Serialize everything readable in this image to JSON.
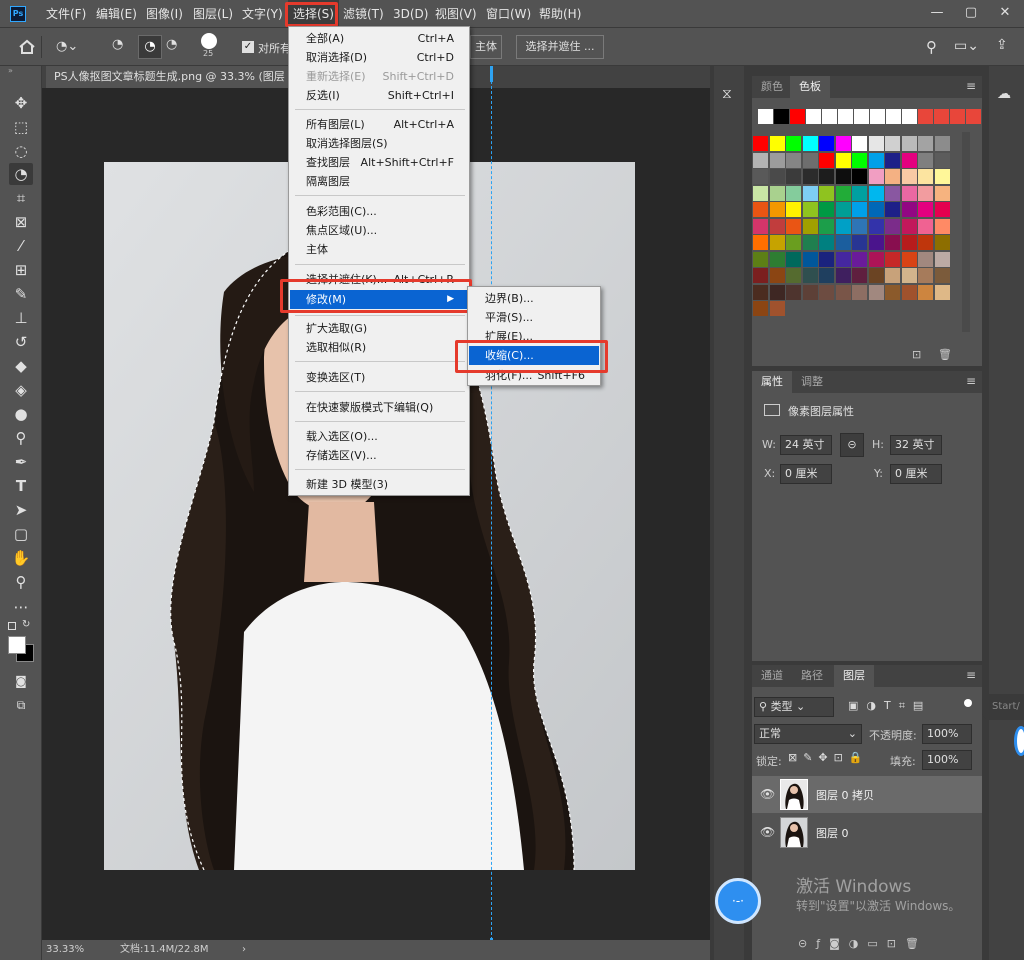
{
  "app": {
    "logo": "Ps"
  },
  "menubar": {
    "items": [
      "文件(F)",
      "编辑(E)",
      "图像(I)",
      "图层(L)",
      "文字(Y)",
      "选择(S)",
      "滤镜(T)",
      "3D(D)",
      "视图(V)",
      "窗口(W)",
      "帮助(H)"
    ],
    "window_controls": [
      "—",
      "▢",
      "✕"
    ]
  },
  "options_bar": {
    "brush_size": "25",
    "sample_all_label": "对所有",
    "subject_button": "主体",
    "select_mask_button": "选择并遮住 ..."
  },
  "document": {
    "tab_title": "PS人像抠图文章标题生成.png @ 33.3% (图层",
    "zoom": "33.33%",
    "doc_info": "文档:11.4M/22.8M"
  },
  "select_menu": {
    "items": [
      {
        "label": "全部(A)",
        "shortcut": "Ctrl+A"
      },
      {
        "label": "取消选择(D)",
        "shortcut": "Ctrl+D"
      },
      {
        "label": "重新选择(E)",
        "shortcut": "Shift+Ctrl+D",
        "disabled": true
      },
      {
        "label": "反选(I)",
        "shortcut": "Shift+Ctrl+I"
      },
      {
        "label": "所有图层(L)",
        "shortcut": "Alt+Ctrl+A"
      },
      {
        "label": "取消选择图层(S)",
        "shortcut": ""
      },
      {
        "label": "查找图层",
        "shortcut": "Alt+Shift+Ctrl+F"
      },
      {
        "label": "隔离图层",
        "shortcut": ""
      },
      {
        "label": "色彩范围(C)...",
        "shortcut": ""
      },
      {
        "label": "焦点区域(U)...",
        "shortcut": ""
      },
      {
        "label": "主体",
        "shortcut": ""
      },
      {
        "label": "选择并遮住(K)...",
        "shortcut": "Alt+Ctrl+R"
      },
      {
        "label": "修改(M)",
        "shortcut": ""
      },
      {
        "label": "扩大选取(G)",
        "shortcut": ""
      },
      {
        "label": "选取相似(R)",
        "shortcut": ""
      },
      {
        "label": "变换选区(T)",
        "shortcut": ""
      },
      {
        "label": "在快速蒙版模式下编辑(Q)",
        "shortcut": ""
      },
      {
        "label": "载入选区(O)...",
        "shortcut": ""
      },
      {
        "label": "存储选区(V)...",
        "shortcut": ""
      },
      {
        "label": "新建 3D 模型(3)",
        "shortcut": ""
      }
    ]
  },
  "modify_submenu": {
    "items": [
      {
        "label": "边界(B)...",
        "shortcut": ""
      },
      {
        "label": "平滑(S)...",
        "shortcut": ""
      },
      {
        "label": "扩展(E)...",
        "shortcut": ""
      },
      {
        "label": "收缩(C)...",
        "shortcut": ""
      },
      {
        "label": "羽化(F)...",
        "shortcut": "Shift+F6"
      }
    ]
  },
  "swatches_panel": {
    "tabs": [
      "颜色",
      "色板"
    ],
    "recent_colors": [
      "#ffffff",
      "#000000",
      "#ff0000",
      "#ffffff",
      "#ffffff",
      "#ffffff",
      "#ffffff",
      "#ffffff",
      "#ffffff",
      "#ffffff",
      "#e8463a",
      "#e8463a",
      "#e8463a",
      "#e8463a"
    ],
    "grid": [
      [
        "#ff0000",
        "#ffff00",
        "#00ff00",
        "#00ffff",
        "#0000ff",
        "#ff00ff",
        "#ffffff",
        "#e6e6e6",
        "#d0d0d0",
        "#bababa",
        "#a3a3a3",
        "#8c8c8c"
      ],
      [
        "#b3b3b3",
        "#9c9c9c",
        "#858585",
        "#6e6e6e",
        "#ff0000",
        "#ffff00",
        "#00ff00",
        "#00a0e9",
        "#1d2088",
        "#e4007f",
        "#7f7f7f",
        "#5c5c5c"
      ],
      [
        "#595959",
        "#4a4a4a",
        "#3b3b3b",
        "#2c2c2c",
        "#1d1d1d",
        "#0e0e0e",
        "#000000",
        "#f19ec2",
        "#f4b183",
        "#f8c9a4",
        "#fce4a0",
        "#fff799"
      ],
      [
        "#c9e6a5",
        "#a9d18e",
        "#84cc9c",
        "#7ecef4",
        "#8fc31f",
        "#22ac38",
        "#00a0a0",
        "#00b7ee",
        "#8957a1",
        "#ea68a2",
        "#f29c9f",
        "#f6b37f"
      ],
      [
        "#e95513",
        "#f39800",
        "#fff100",
        "#8fc31f",
        "#009944",
        "#009e96",
        "#00a0e9",
        "#0068b7",
        "#1d2088",
        "#920783",
        "#e4007f",
        "#e5004f"
      ],
      [
        "#d4356a",
        "#c13d3d",
        "#ea5514",
        "#a0a000",
        "#1c9e4a",
        "#00a0c6",
        "#2e75b6",
        "#3333aa",
        "#7b2c8a",
        "#c2185b",
        "#f06292",
        "#ff8a65"
      ],
      [
        "#ff6f00",
        "#c6a300",
        "#6a9e1f",
        "#1f7f4f",
        "#008080",
        "#1b5e9e",
        "#283593",
        "#4a148c",
        "#880e4f",
        "#b71c1c",
        "#bf360c",
        "#8d6e00"
      ],
      [
        "#5d7f16",
        "#2e7d32",
        "#00695c",
        "#01579b",
        "#1a237e",
        "#4527a0",
        "#6a1b9a",
        "#ad1457",
        "#c62828",
        "#d84315",
        "#a1887f",
        "#bcaaa4"
      ],
      [
        "#7b1f1f",
        "#8b4513",
        "#556b2f",
        "#2f4f4f",
        "#1f3f5f",
        "#3f1f5f",
        "#5f1f3f",
        "#6b4423",
        "#c8a27a",
        "#d2b48c",
        "#a67b5b",
        "#7b5b3b"
      ],
      [
        "#4b2c20",
        "#3e2723",
        "#4e342e",
        "#5d4037",
        "#6d4c41",
        "#795548",
        "#8d6e63",
        "#a1887f",
        "#8b5a2b",
        "#a0522d",
        "#cd853f",
        "#deb887"
      ],
      [
        "#8b4513",
        "#a0522d"
      ]
    ]
  },
  "properties_panel": {
    "tabs": [
      "属性",
      "调整"
    ],
    "title": "像素图层属性",
    "w_label": "W:",
    "w_value": "24 英寸",
    "h_label": "H:",
    "h_value": "32 英寸",
    "x_label": "X:",
    "x_value": "0 厘米",
    "y_label": "Y:",
    "y_value": "0 厘米"
  },
  "layers_panel": {
    "tabs": [
      "通道",
      "路径",
      "图层"
    ],
    "filter": "类型",
    "blend_mode": "正常",
    "opacity_label": "不透明度:",
    "opacity": "100%",
    "lock_label": "锁定:",
    "fill_label": "填充:",
    "fill": "100%",
    "layers": [
      {
        "name": "图层 0 拷贝",
        "selected": true
      },
      {
        "name": "图层 0",
        "selected": false
      }
    ]
  },
  "watermark": {
    "line1": "激活 Windows",
    "line2": "转到\"设置\"以激活 Windows。"
  },
  "side_hint": "Start/",
  "colors": {
    "accent": "#0a64d2",
    "highlight_box": "#e53a2c",
    "guide": "#2ea3f2"
  }
}
